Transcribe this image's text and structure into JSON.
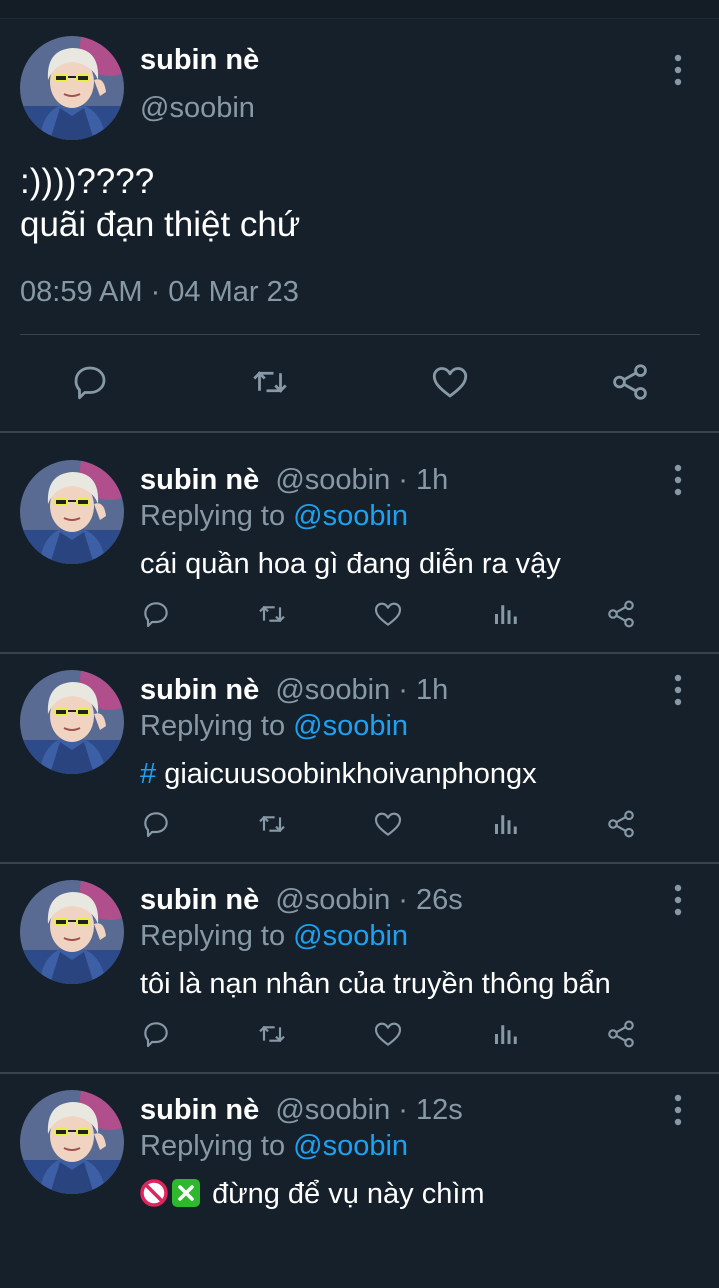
{
  "main_tweet": {
    "display_name": "subin nè",
    "handle": "@soobin",
    "text_line1": ":))))????",
    "text_line2": "quãi đạn thiệt chứ",
    "timestamp": "08:59 AM · 04 Mar 23",
    "actions": [
      "reply-icon",
      "retweet-icon",
      "like-icon",
      "share-icon"
    ]
  },
  "replies": [
    {
      "display_name": "subin nè",
      "handle_time": "@soobin · 1h",
      "replying_prefix": "Replying to",
      "replying_mention": "@soobin",
      "text": "cái quần hoa gì đang diễn ra vậy"
    },
    {
      "display_name": "subin nè",
      "handle_time": "@soobin · 1h",
      "replying_prefix": "Replying to",
      "replying_mention": "@soobin",
      "hashtag_symbol": "#",
      "text": "giaicuusoobinkhoivanphongx"
    },
    {
      "display_name": "subin nè",
      "handle_time": "@soobin · 26s",
      "replying_prefix": "Replying to",
      "replying_mention": "@soobin",
      "text": "tôi là nạn nhân của truyền thông bẩn"
    },
    {
      "display_name": "subin nè",
      "handle_time": "@soobin · 12s",
      "replying_prefix": "Replying to",
      "replying_mention": "@soobin",
      "emojis": [
        "no-entry-emoji",
        "cross-mark-emoji"
      ],
      "text": "đừng để vụ này chìm"
    }
  ],
  "reply_actions": [
    "reply-icon",
    "retweet-icon",
    "like-icon",
    "analytics-icon",
    "share-icon"
  ],
  "colors": {
    "background": "#15202b",
    "secondary_text": "#8899a6",
    "link": "#1da1f2",
    "divider": "#38444d"
  }
}
